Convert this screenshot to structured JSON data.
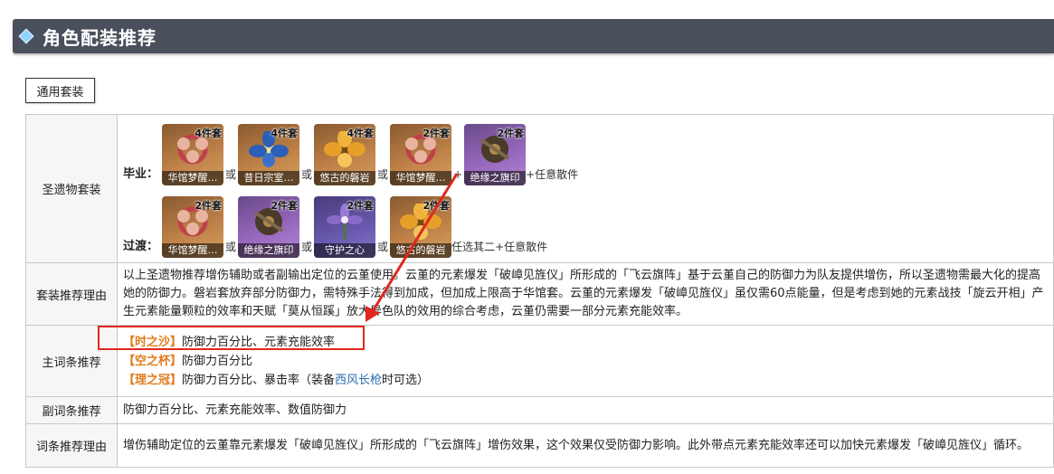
{
  "header": {
    "title": "角色配装推荐"
  },
  "tabs": [
    {
      "label": "通用套装"
    }
  ],
  "artifacts": {
    "row_label": "圣遗物套装",
    "best": {
      "tier_label": "毕业：",
      "items": [
        {
          "pieces": "4件套",
          "name": "华馆梦醒…",
          "icon": "knot-icon"
        },
        {
          "pieces": "4件套",
          "name": "昔日宗室…",
          "icon": "blue-flower-icon"
        },
        {
          "pieces": "4件套",
          "name": "悠古的磐岩",
          "icon": "golden-flower-icon"
        },
        {
          "pieces": "2件套",
          "name": "华馆梦醒…",
          "icon": "knot-icon"
        },
        {
          "pieces": "2件套",
          "name": "绝缘之旗印",
          "icon": "tsuba-icon"
        }
      ],
      "separators": [
        "或",
        "或",
        "或",
        "+"
      ],
      "tail": "+任意散件"
    },
    "transition": {
      "tier_label": "过渡：",
      "items": [
        {
          "pieces": "2件套",
          "name": "华馆梦醒…",
          "icon": "knot-icon"
        },
        {
          "pieces": "2件套",
          "name": "绝缘之旗印",
          "icon": "tsuba-icon"
        },
        {
          "pieces": "2件套",
          "name": "守护之心",
          "icon": "purple-flower-icon"
        },
        {
          "pieces": "2件套",
          "name": "悠古的磐岩",
          "icon": "golden-flower-icon"
        }
      ],
      "separators": [
        "或",
        "或",
        "或"
      ],
      "tail": "任选其二+任意散件"
    }
  },
  "set_reason": {
    "label": "套装推荐理由",
    "text": "以上圣遗物推荐增伤辅助或者副输出定位的云堇使用。云堇的元素爆发「破嶂见旌仪」所形成的「飞云旗阵」基于云堇自己的防御力为队友提供增伤，所以圣遗物需最大化的提高她的防御力。磐岩套放弃部分防御力，需特殊手法得到加成，但加成上限高于华馆套。云堇的元素爆发「破嶂见旌仪」虽仅需60点能量，但是考虑到她的元素战技「旋云开相」产生元素能量颗粒的效率和天赋「莫从恒蹊」放大异色队的效用的综合考虑，云堇仍需要一部分元素充能效率。"
  },
  "main_stats": {
    "label": "主词条推荐",
    "lines": [
      {
        "slot": "【时之沙】",
        "value": "防御力百分比、元素充能效率"
      },
      {
        "slot": "【空之杯】",
        "value": "防御力百分比"
      },
      {
        "slot": "【理之冠】",
        "value": "防御力百分比、暴击率（装备",
        "link": "西风长枪",
        "after": "时可选）"
      }
    ]
  },
  "sub_stats": {
    "label": "副词条推荐",
    "text": "防御力百分比、元素充能效率、数值防御力"
  },
  "sub_reason": {
    "label": "词条推荐理由",
    "text": "增伤辅助定位的云堇靠元素爆发「破嶂见旌仪」所形成的「飞云旗阵」增伤效果，这个效果仅受防御力影响。此外带点元素充能效率还可以加快元素爆发「破嶂见旌仪」循环。"
  },
  "colors": {
    "header_bg": "#4a4f5c",
    "accent": "#e07c1e",
    "annotation_red": "#e0281e",
    "link": "#2a6fb0"
  }
}
